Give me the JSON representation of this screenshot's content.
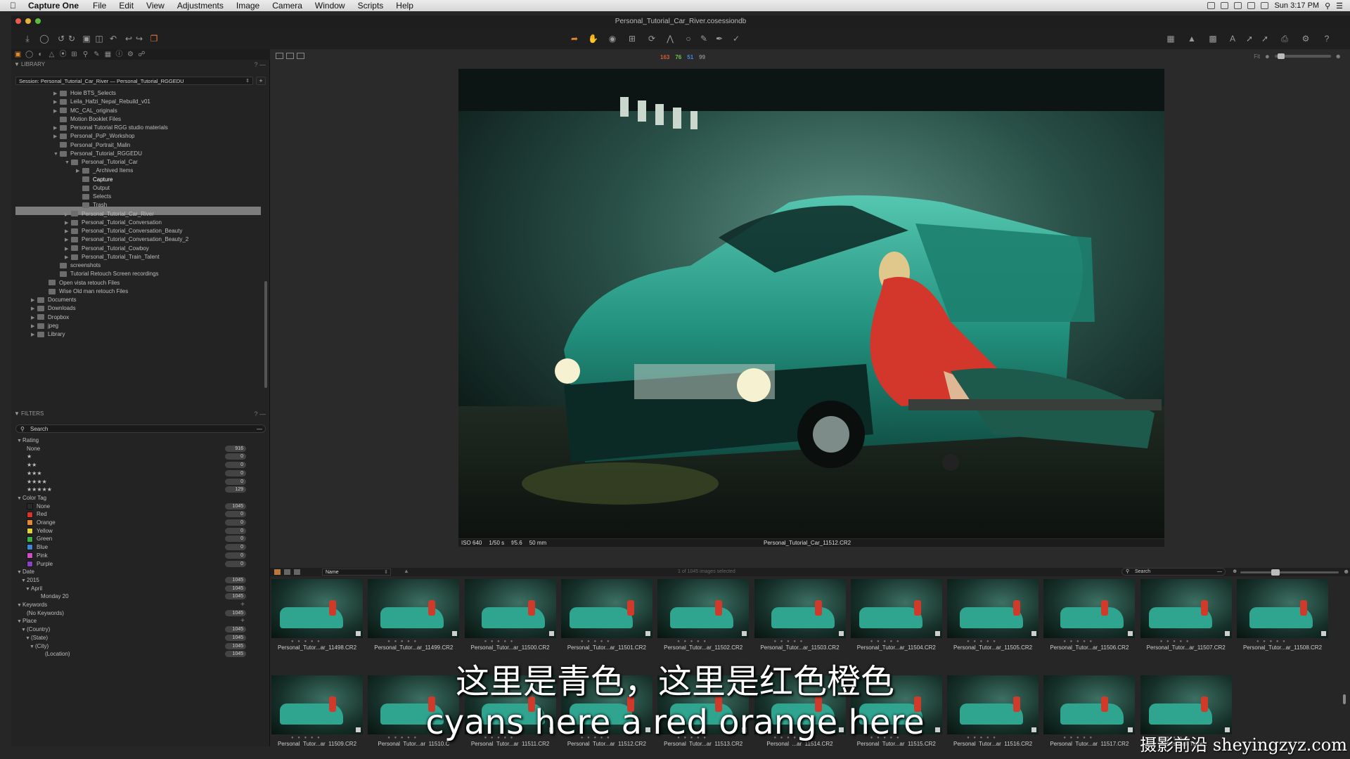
{
  "menubar": {
    "app_name": "Capture One",
    "menus": [
      "File",
      "Edit",
      "View",
      "Adjustments",
      "Image",
      "Camera",
      "Window",
      "Scripts",
      "Help"
    ],
    "clock": "Sun 3:17 PM"
  },
  "window": {
    "title": "Personal_Tutorial_Car_River.cosessiondb"
  },
  "viewer": {
    "counters": [
      {
        "value": "163",
        "color": "#d35a3a"
      },
      {
        "value": "76",
        "color": "#6fc34b"
      },
      {
        "value": "51",
        "color": "#4a86d8"
      },
      {
        "value": "99",
        "color": "#888888"
      }
    ],
    "fit_label": "Fit",
    "photo_info": [
      "ISO 640",
      "1/50 s",
      "f/5.6",
      "50 mm"
    ],
    "photo_filename": "Personal_Tutorial_Car_11512.CR2"
  },
  "library": {
    "header": "LIBRARY",
    "session": "Session: Personal_Tutorial_Car_River — Personal_Tutorial_RGGEDU",
    "tree": [
      {
        "label": "Hoie BTS_Selects",
        "level": 3,
        "expand": true
      },
      {
        "label": "Leila_Hafzi_Nepal_Rebuild_v01",
        "level": 3,
        "expand": true
      },
      {
        "label": "MC_CAL_originals",
        "level": 3,
        "expand": true
      },
      {
        "label": "Motion Booklet Files",
        "level": 3,
        "expand": false
      },
      {
        "label": "Personal Tutorial RGG studio materials",
        "level": 3,
        "expand": true
      },
      {
        "label": "Personal_PoP_Workshop",
        "level": 3,
        "expand": true
      },
      {
        "label": "Personal_Portrait_Malin",
        "level": 3,
        "expand": false
      },
      {
        "label": "Personal_Tutorial_RGGEDU",
        "level": 3,
        "expand": true,
        "open": true
      },
      {
        "label": "Personal_Tutorial_Car",
        "level": 4,
        "expand": true,
        "open": true
      },
      {
        "label": "_Archived Items",
        "level": 5,
        "expand": true
      },
      {
        "label": "Capture",
        "level": 5,
        "expand": false,
        "selected": true
      },
      {
        "label": "Output",
        "level": 5,
        "expand": false
      },
      {
        "label": "Selects",
        "level": 5,
        "expand": false
      },
      {
        "label": "Trash",
        "level": 5,
        "expand": false
      },
      {
        "label": "Personal_Tutorial_Car_River",
        "level": 4,
        "expand": true
      },
      {
        "label": "Personal_Tutorial_Conversation",
        "level": 4,
        "expand": true
      },
      {
        "label": "Personal_Tutorial_Conversation_Beauty",
        "level": 4,
        "expand": true
      },
      {
        "label": "Personal_Tutorial_Conversation_Beauty_2",
        "level": 4,
        "expand": true
      },
      {
        "label": "Personal_Tutorial_Cowboy",
        "level": 4,
        "expand": true
      },
      {
        "label": "Personal_Tutorial_Train_Talent",
        "level": 4,
        "expand": true
      },
      {
        "label": "screenshots",
        "level": 3,
        "expand": false
      },
      {
        "label": "Tutorial Retouch Screen recordings",
        "level": 3,
        "expand": false
      },
      {
        "label": "Open vista retouch Files",
        "level": 2,
        "expand": false
      },
      {
        "label": "Wise Old man retouch Files",
        "level": 2,
        "expand": false
      },
      {
        "label": "Documents",
        "level": 1,
        "expand": true
      },
      {
        "label": "Downloads",
        "level": 1,
        "expand": true
      },
      {
        "label": "Dropbox",
        "level": 1,
        "expand": true
      },
      {
        "label": "jpeg",
        "level": 1,
        "expand": true
      },
      {
        "label": "Library",
        "level": 1,
        "expand": true
      }
    ]
  },
  "filters": {
    "header": "FILTERS",
    "search_placeholder": "Search",
    "rating_label": "Rating",
    "ratings": [
      {
        "label": "None",
        "count": "916"
      },
      {
        "label": "★",
        "count": "0"
      },
      {
        "label": "★★",
        "count": "0"
      },
      {
        "label": "★★★",
        "count": "0"
      },
      {
        "label": "★★★★",
        "count": "0"
      },
      {
        "label": "★★★★★",
        "count": "129"
      }
    ],
    "color_tag_label": "Color Tag",
    "color_tags": [
      {
        "label": "None",
        "count": "1045",
        "color": "#2a2a2a"
      },
      {
        "label": "Red",
        "count": "0",
        "color": "#d8322b"
      },
      {
        "label": "Orange",
        "count": "0",
        "color": "#e58a2a"
      },
      {
        "label": "Yellow",
        "count": "0",
        "color": "#e0d230"
      },
      {
        "label": "Green",
        "count": "0",
        "color": "#36b24a"
      },
      {
        "label": "Blue",
        "count": "0",
        "color": "#3c86d6"
      },
      {
        "label": "Pink",
        "count": "0",
        "color": "#d24ec6"
      },
      {
        "label": "Purple",
        "count": "0",
        "color": "#8844c0"
      }
    ],
    "date_label": "Date",
    "dates": [
      {
        "label": "2015",
        "count": "1045",
        "level": 1
      },
      {
        "label": "April",
        "count": "1045",
        "level": 2
      },
      {
        "label": "Monday 20",
        "count": "1045",
        "level": 3
      }
    ],
    "keywords_label": "Keywords",
    "keywords": [
      {
        "label": "(No Keywords)",
        "count": "1045"
      }
    ],
    "place_label": "Place",
    "places": [
      {
        "label": "(Country)",
        "count": "1045",
        "level": 1
      },
      {
        "label": "(State)",
        "count": "1045",
        "level": 2
      },
      {
        "label": "(City)",
        "count": "1045",
        "level": 3
      },
      {
        "label": "(Location)",
        "count": "1045",
        "level": 4
      }
    ]
  },
  "browser": {
    "sort_label": "Name",
    "selection_text": "1 of 1045 images selected",
    "search_placeholder": "Search",
    "row1": [
      "Personal_Tutor...ar_11498.CR2",
      "Personal_Tutor...ar_11499.CR2",
      "Personal_Tutor...ar_11500.CR2",
      "Personal_Tutor...ar_11501.CR2",
      "Personal_Tutor...ar_11502.CR2",
      "Personal_Tutor...ar_11503.CR2",
      "Personal_Tutor...ar_11504.CR2",
      "Personal_Tutor...ar_11505.CR2",
      "Personal_Tutor...ar_11506.CR2",
      "Personal_Tutor...ar_11507.CR2",
      "Personal_Tutor...ar_11508.CR2"
    ],
    "row2": [
      "Personal_Tutor...ar_11509.CR2",
      "Personal_Tutor...ar_11510.C",
      "Personal_Tutor...ar_11511.CR2",
      "Personal_Tutor...ar_11512.CR2",
      "Personal_Tutor...ar_11513.CR2",
      "Personal_...ar_11514.CR2",
      "Personal_Tutor...ar_11515.CR2",
      "Personal_Tutor...ar_11516.CR2",
      "Personal_Tutor...ar_11517.CR2",
      "Personal_Tutor..."
    ]
  },
  "subtitles": {
    "chinese": "这里是青色，这里是红色橙色",
    "english": "cyans here a red orange here"
  },
  "watermark": "摄影前沿 sheyingzyz.com"
}
